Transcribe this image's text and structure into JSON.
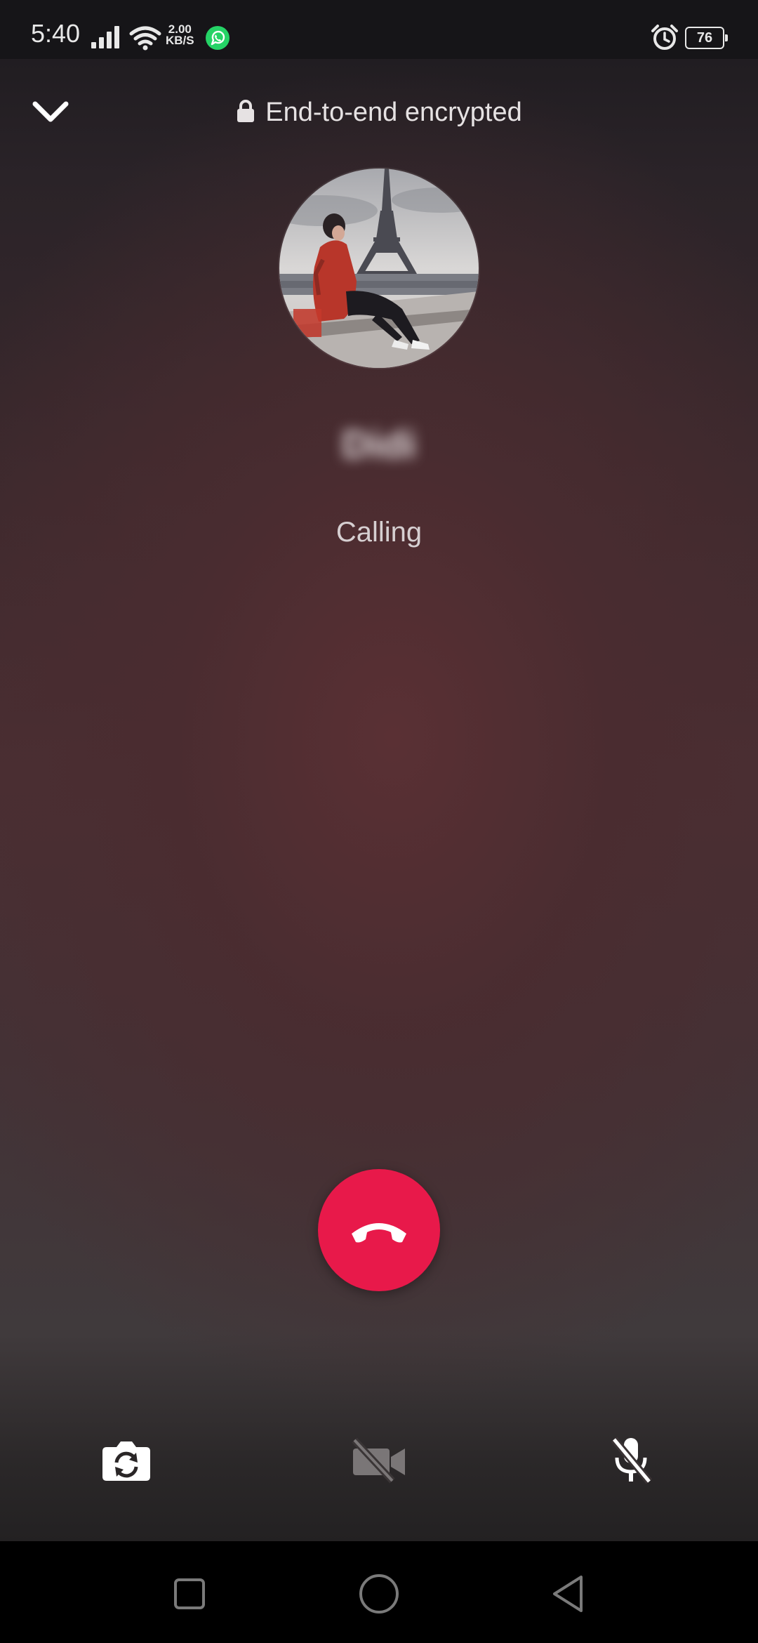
{
  "status_bar": {
    "time": "5:40",
    "net_speed_value": "2.00",
    "net_speed_unit": "KB/S",
    "battery_level": "76",
    "icons": [
      "signal-icon",
      "wifi-icon",
      "whatsapp-icon",
      "alarm-icon",
      "battery-icon"
    ]
  },
  "header": {
    "encryption_label": "End-to-end encrypted",
    "icons": [
      "chevron-down-icon",
      "lock-icon"
    ]
  },
  "call": {
    "contact_name": "Didi",
    "status": "Calling",
    "end_call_icon": "phone-hangup-icon"
  },
  "controls": {
    "icons": [
      "camera-switch-icon",
      "video-off-icon",
      "mic-off-icon"
    ]
  },
  "nav": {
    "icons": [
      "recents-square-icon",
      "home-circle-icon",
      "back-triangle-icon"
    ]
  },
  "colors": {
    "end_call": "#e8194a",
    "whatsapp": "#25d366"
  }
}
